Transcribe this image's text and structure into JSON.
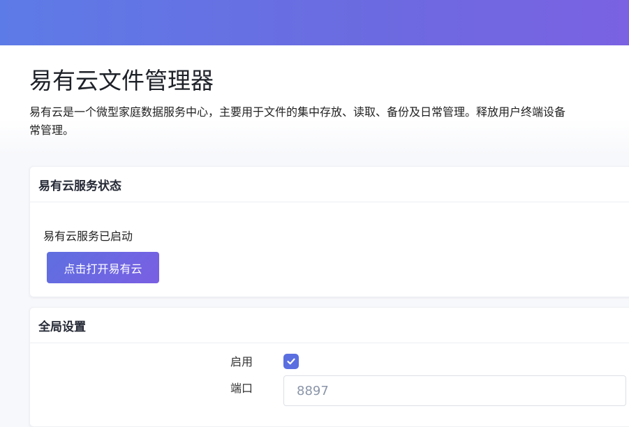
{
  "page": {
    "title": "易有云文件管理器",
    "description_line1": "易有云是一个微型家庭数据服务中心，主要用于文件的集中存放、读取、备份及日常管理。释放用户终端设备",
    "description_line2": "常管理。"
  },
  "status_card": {
    "header": "易有云服务状态",
    "status_text": "易有云服务已启动",
    "open_button_label": "点击打开易有云"
  },
  "global_card": {
    "header": "全局设置",
    "enable_label": "启用",
    "enable_checked": true,
    "port_label": "端口",
    "port_placeholder": "8897"
  },
  "colors": {
    "accent": "#5b6fe0",
    "topbar_start": "#5d7be6",
    "topbar_end": "#7a62e2"
  },
  "icons": {
    "checkbox": "check-icon"
  }
}
